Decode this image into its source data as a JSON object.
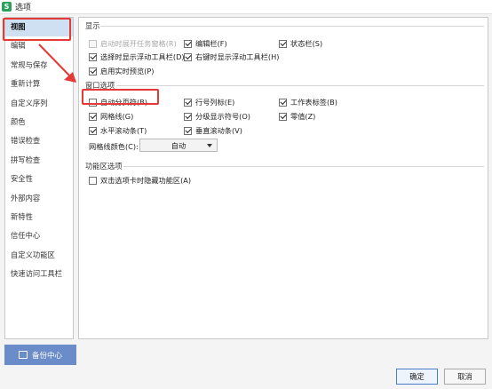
{
  "window": {
    "title": "选项"
  },
  "sidebar": {
    "items": [
      {
        "label": "视图"
      },
      {
        "label": "编辑"
      },
      {
        "label": "常规与保存"
      },
      {
        "label": "重新计算"
      },
      {
        "label": "自定义序列"
      },
      {
        "label": "颜色"
      },
      {
        "label": "错误检查"
      },
      {
        "label": "拼写检查"
      },
      {
        "label": "安全性"
      },
      {
        "label": "外部内容"
      },
      {
        "label": "新特性"
      },
      {
        "label": "信任中心"
      },
      {
        "label": "自定义功能区"
      },
      {
        "label": "快速访问工具栏"
      }
    ]
  },
  "backup": {
    "label": "备份中心"
  },
  "display": {
    "title": "显示",
    "options": [
      {
        "label": "启动时展开任务窗格(R)",
        "checked": false,
        "disabled": true
      },
      {
        "label": "编辑栏(F)",
        "checked": true
      },
      {
        "label": "状态栏(S)",
        "checked": true
      },
      {
        "label": "选择时显示浮动工具栏(D)",
        "checked": true
      },
      {
        "label": "右键时显示浮动工具栏(H)",
        "checked": true
      },
      {
        "label": "启用实时预览(P)",
        "checked": true
      }
    ]
  },
  "window_options": {
    "title": "窗口选项",
    "options": [
      {
        "label": "自动分页符(B)",
        "checked": false
      },
      {
        "label": "行号列标(E)",
        "checked": true
      },
      {
        "label": "工作表标签(B)",
        "checked": true
      },
      {
        "label": "网格线(G)",
        "checked": true
      },
      {
        "label": "分级显示符号(O)",
        "checked": true
      },
      {
        "label": "零值(Z)",
        "checked": true
      },
      {
        "label": "水平滚动条(T)",
        "checked": true
      },
      {
        "label": "垂直滚动条(V)",
        "checked": true
      }
    ],
    "grid_color": {
      "label": "网格线颜色(C):",
      "value": "自动"
    }
  },
  "ribbon": {
    "title": "功能区选项",
    "options": [
      {
        "label": "双击选项卡时隐藏功能区(A)",
        "checked": false
      }
    ]
  },
  "footer": {
    "ok": "确定",
    "cancel": "取消"
  },
  "colors": {
    "accent": "#6a8cc8",
    "selected_bg": "#cfe0f2",
    "annotation": "#e53935"
  }
}
